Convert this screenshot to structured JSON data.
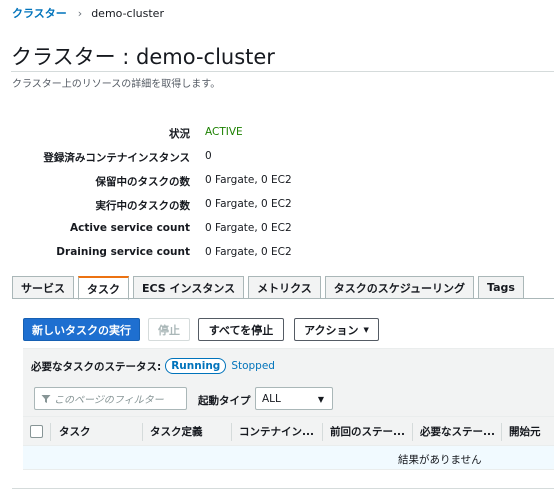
{
  "breadcrumb": {
    "parent": "クラスター",
    "current": "demo-cluster"
  },
  "page": {
    "title": "クラスター : demo-cluster",
    "description": "クラスター上のリソースの詳細を取得します。"
  },
  "details": [
    {
      "key": "状況",
      "value": "ACTIVE"
    },
    {
      "key": "登録済みコンテナインスタンス",
      "value": "0"
    },
    {
      "key": "保留中のタスクの数",
      "value": "0 Fargate, 0 EC2"
    },
    {
      "key": "実行中のタスクの数",
      "value": "0 Fargate, 0 EC2"
    },
    {
      "key": "Active service count",
      "value": "0 Fargate, 0 EC2"
    },
    {
      "key": "Draining service count",
      "value": "0 Fargate, 0 EC2"
    }
  ],
  "tabs": [
    "サービス",
    "タスク",
    "ECS インスタンス",
    "メトリクス",
    "タスクのスケジューリング",
    "Tags"
  ],
  "selected_tab": "タスク",
  "toolbar": {
    "run_task": "新しいタスクの実行",
    "stop": "停止",
    "stop_all": "すべてを停止",
    "actions": "アクション"
  },
  "status_filter": {
    "label": "必要なタスクのステータス:",
    "running": "Running",
    "stopped": "Stopped"
  },
  "filter": {
    "placeholder": "このページのフィルター",
    "launch_type_label": "起動タイプ",
    "launch_type_value": "ALL"
  },
  "table": {
    "columns": [
      "タスク",
      "タスク定義",
      "コンテナイン...",
      "前回のステー...",
      "必要なステー...",
      "開始元"
    ],
    "empty_message": "結果がありません"
  },
  "colors": {
    "primary_button": "#1e6fd0",
    "link": "#0073bb",
    "active_status": "#1d8102",
    "tab_accent": "#ec7211"
  }
}
